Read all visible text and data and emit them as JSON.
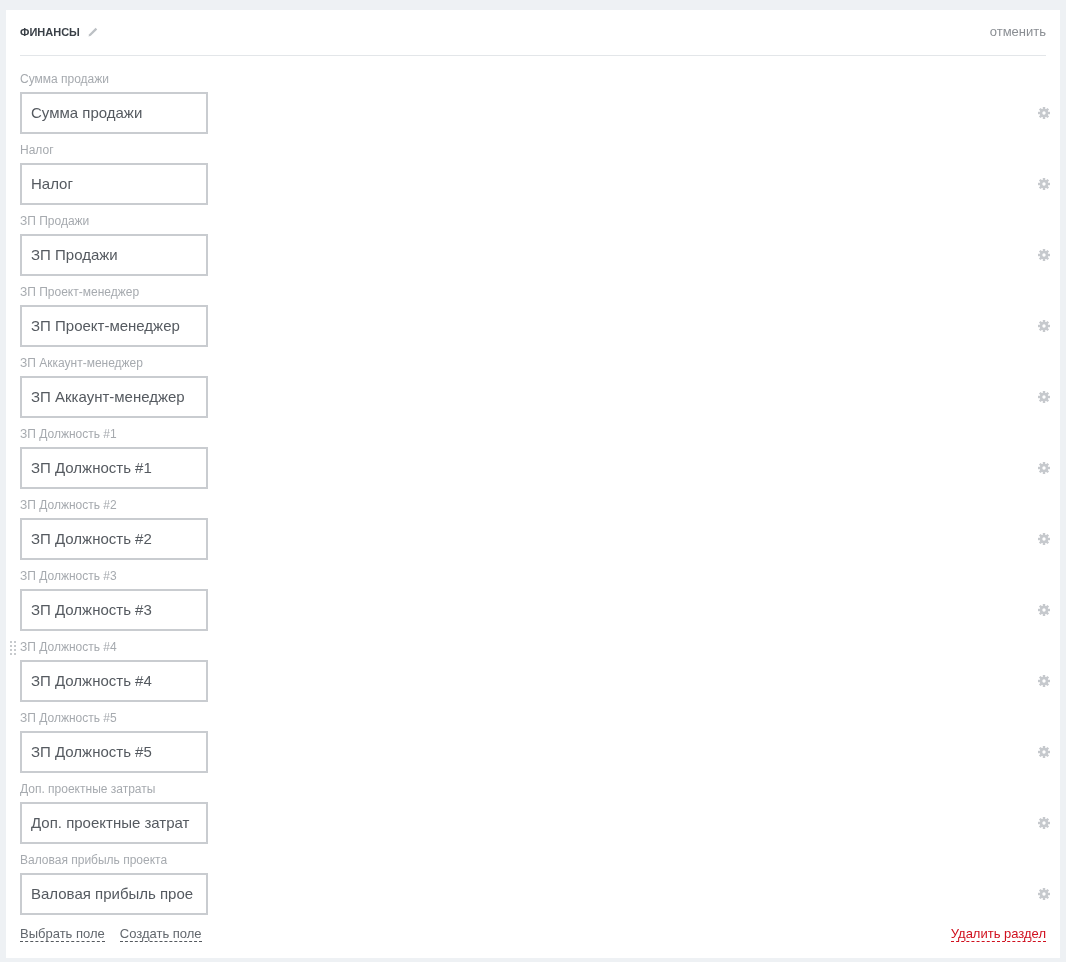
{
  "section": {
    "title": "ФИНАНСЫ",
    "cancel": "отменить"
  },
  "fields": [
    {
      "label": "Сумма продажи",
      "value": "Сумма продажи",
      "hovered": false
    },
    {
      "label": "Налог",
      "value": "Налог",
      "hovered": false
    },
    {
      "label": "ЗП Продажи",
      "value": "ЗП Продажи",
      "hovered": false
    },
    {
      "label": "ЗП Проект-менеджер",
      "value": "ЗП Проект-менеджер",
      "hovered": false
    },
    {
      "label": "ЗП Аккаунт-менеджер",
      "value": "ЗП Аккаунт-менеджер",
      "hovered": false
    },
    {
      "label": "ЗП Должность #1",
      "value": "ЗП Должность #1",
      "hovered": false
    },
    {
      "label": "ЗП Должность #2",
      "value": "ЗП Должность #2",
      "hovered": false
    },
    {
      "label": "ЗП Должность #3",
      "value": "ЗП Должность #3",
      "hovered": false
    },
    {
      "label": "ЗП Должность #4",
      "value": "ЗП Должность #4",
      "hovered": true
    },
    {
      "label": "ЗП Должность #5",
      "value": "ЗП Должность #5",
      "hovered": false
    },
    {
      "label": "Доп. проектные затраты",
      "value": "Доп. проектные затрат",
      "hovered": false
    },
    {
      "label": "Валовая прибыль проекта",
      "value": "Валовая прибыль прое",
      "hovered": false
    }
  ],
  "footer": {
    "links": [
      "Выбрать поле",
      "Создать поле"
    ],
    "delete": "Удалить раздел"
  }
}
